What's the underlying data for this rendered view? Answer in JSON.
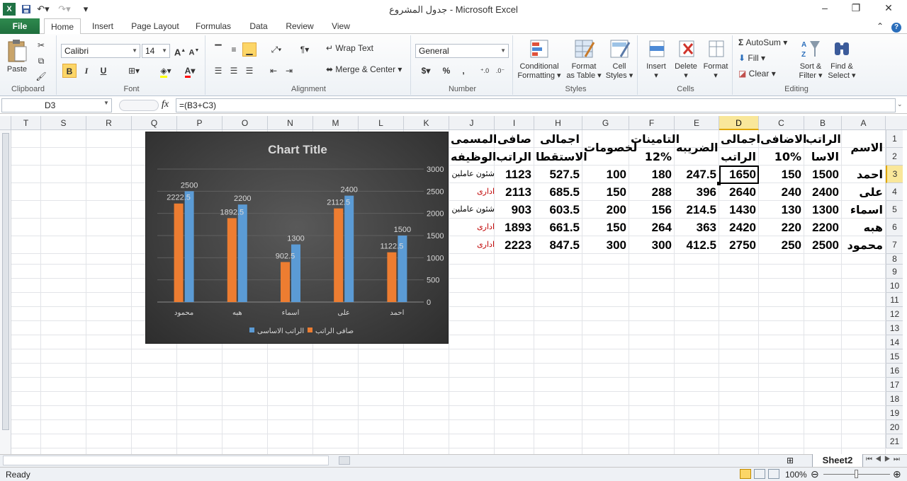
{
  "window": {
    "title": "جدول المشروع  -  Microsoft Excel",
    "minimize": "–",
    "restore": "❐",
    "close": "✕"
  },
  "tabs": [
    "File",
    "Home",
    "Insert",
    "Page Layout",
    "Formulas",
    "Data",
    "Review",
    "View"
  ],
  "ribbon": {
    "clipboard": {
      "paste": "Paste",
      "label": "Clipboard"
    },
    "font": {
      "name": "Calibri",
      "size": "14",
      "label": "Font",
      "bold": "B",
      "italic": "I",
      "underline": "U",
      "grow": "A",
      "shrink": "A",
      "color_letter": "A"
    },
    "alignment": {
      "wrap": "Wrap Text",
      "merge": "Merge & Center",
      "label": "Alignment"
    },
    "number": {
      "format": "General",
      "currency": "$",
      "percent": "%",
      "comma": ",",
      "label": "Number"
    },
    "styles": {
      "conditional": "Conditional",
      "conditional2": "Formatting",
      "format_table": "Format",
      "format_table2": "as Table",
      "cell_styles": "Cell",
      "cell_styles2": "Styles",
      "label": "Styles"
    },
    "cells": {
      "insert": "Insert",
      "delete": "Delete",
      "format": "Format",
      "label": "Cells"
    },
    "editing": {
      "autosum": "AutoSum",
      "fill": "Fill",
      "clear": "Clear",
      "sort": "Sort &",
      "sort2": "Filter",
      "find": "Find &",
      "find2": "Select",
      "label": "Editing"
    }
  },
  "formula_bar": {
    "name_box": "D3",
    "fx": "fx",
    "formula": "=(B3+C3)"
  },
  "columns": [
    "T",
    "S",
    "R",
    "Q",
    "P",
    "O",
    "N",
    "M",
    "L",
    "K",
    "J",
    "I",
    "H",
    "G",
    "F",
    "E",
    "D",
    "C",
    "B",
    "A"
  ],
  "rows": [
    "1",
    "2",
    "3",
    "4",
    "5",
    "6",
    "7",
    "8",
    "9",
    "10",
    "11",
    "12",
    "13",
    "14",
    "15",
    "16",
    "17",
    "18",
    "19",
    "20",
    "21"
  ],
  "headers": {
    "A": "الاسم",
    "B1": "الراتب",
    "B2": "الاسا",
    "C1": "الاضافى",
    "C2": "10%",
    "D1": "اجمالى",
    "D2": "الراتب",
    "E": "الضريبه",
    "F1": "التامينات",
    "F2": "12%",
    "G": "لخصومات",
    "H1": "اجمالى",
    "H2": "الاستقطا",
    "I1": "صافى",
    "I2": "الراتب",
    "J1": "المسمى",
    "J2": "الوظيفه"
  },
  "table": [
    {
      "A": "احمد",
      "B": "1500",
      "C": "150",
      "D": "1650",
      "E": "247.5",
      "F": "180",
      "G": "100",
      "H": "527.5",
      "I": "1123",
      "J": "شئون عاملين"
    },
    {
      "A": "على",
      "B": "2400",
      "C": "240",
      "D": "2640",
      "E": "396",
      "F": "288",
      "G": "150",
      "H": "685.5",
      "I": "2113",
      "J": "ادارى"
    },
    {
      "A": "اسماء",
      "B": "1300",
      "C": "130",
      "D": "1430",
      "E": "214.5",
      "F": "156",
      "G": "200",
      "H": "603.5",
      "I": "903",
      "J": "شئون عاملين"
    },
    {
      "A": "هبه",
      "B": "2200",
      "C": "220",
      "D": "2420",
      "E": "363",
      "F": "264",
      "G": "150",
      "H": "661.5",
      "I": "1893",
      "J": "ادارى"
    },
    {
      "A": "محمود",
      "B": "2500",
      "C": "250",
      "D": "2750",
      "E": "412.5",
      "F": "300",
      "G": "300",
      "H": "847.5",
      "I": "2223",
      "J": "ادارى"
    }
  ],
  "chart_data": {
    "type": "bar",
    "title": "Chart  Title",
    "categories": [
      "احمد",
      "على",
      "اسماء",
      "هبه",
      "محمود"
    ],
    "series": [
      {
        "name": "الراتب الاساسى",
        "values": [
          1500,
          2400,
          1300,
          2200,
          2500
        ],
        "color": "#5b9bd5"
      },
      {
        "name": "صافى الراتب",
        "values": [
          1122.5,
          2112.5,
          902.5,
          1892.5,
          2222.5
        ],
        "color": "#ed7d31"
      }
    ],
    "data_labels": {
      "orange": [
        "1122.5",
        "2112.5",
        "902.5",
        "1892.5",
        "2222.5"
      ],
      "blue": [
        "1500",
        "2400",
        "1300",
        "2200",
        "2500"
      ]
    },
    "ylim": [
      0,
      3000
    ],
    "yticks": [
      "0",
      "500",
      "1000",
      "1500",
      "2000",
      "2500",
      "3000"
    ],
    "axis_side": "right",
    "category_order": "right-to-left",
    "legend_position": "bottom",
    "grid": true
  },
  "sheet": {
    "tab": "Sheet2"
  },
  "status": {
    "ready": "Ready",
    "zoom": "100%"
  }
}
